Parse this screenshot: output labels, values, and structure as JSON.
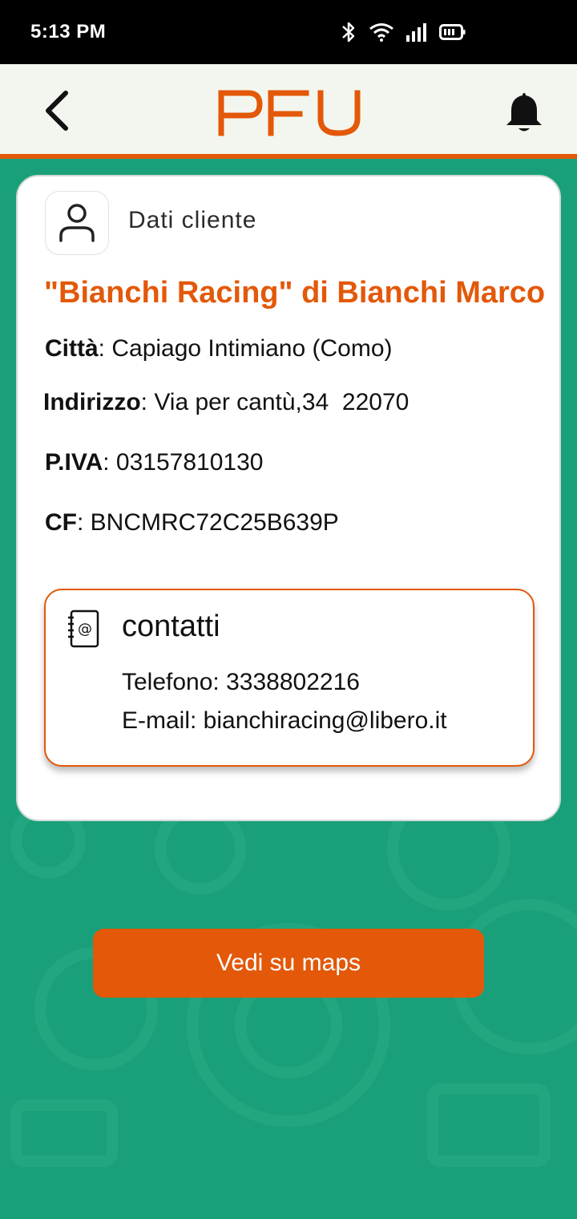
{
  "status_bar": {
    "time": "5:13 PM",
    "icons": [
      "bluetooth-icon",
      "wifi-icon",
      "signal-icon",
      "battery-icon"
    ]
  },
  "header": {
    "logo_text": "PFU",
    "back_icon": "chevron-left-icon",
    "notification_icon": "bell-icon"
  },
  "card": {
    "section_title": "Dati cliente",
    "client_name": "\"Bianchi Racing\" di Bianchi Marco",
    "fields": {
      "citta_label": "Città",
      "citta_value": ": Capiago Intimiano (Como)",
      "indirizzo_label": "Indirizzo",
      "indirizzo_value": ": Via per cantù,34  22070",
      "piva_label": "P.IVA",
      "piva_value": ": 03157810130",
      "cf_label": "CF",
      "cf_value": ": BNCMRC72C25B639P"
    },
    "contacts": {
      "title": "contatti",
      "phone": "Telefono: 3338802216",
      "email": "E-mail: bianchiracing@libero.it"
    }
  },
  "actions": {
    "maps_button": "Vedi su maps"
  },
  "colors": {
    "accent": "#e35809",
    "background": "#19a07a",
    "header_bg": "#f3f6ee"
  }
}
